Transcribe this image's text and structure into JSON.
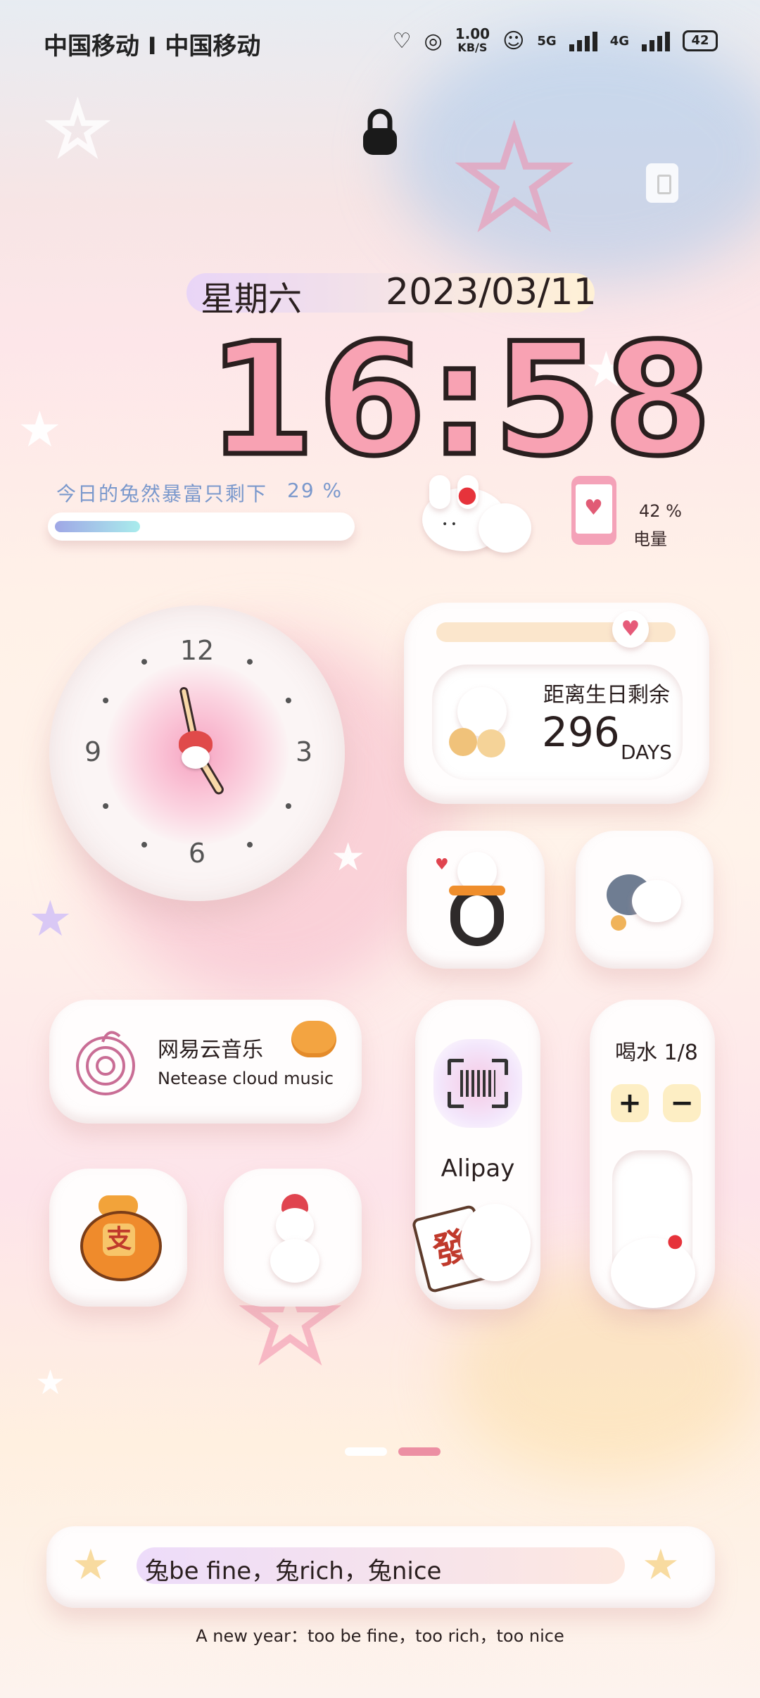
{
  "status_bar": {
    "carrier": "中国移动 I 中国移动",
    "speed_value": "1.00",
    "speed_unit": "KB/S",
    "net1": "5G",
    "net2": "4G",
    "battery": "42"
  },
  "lock": {
    "icon": "lock-icon"
  },
  "date": {
    "weekday": "星期六",
    "date": "2023/03/11"
  },
  "time": "16:58",
  "wealth": {
    "text": "今日的兔然暴富只剩下",
    "percent": "29 %",
    "progress": 0.29
  },
  "phone_battery": {
    "percent": "42 %",
    "label": "电量"
  },
  "clock": {
    "n12": "12",
    "n3": "3",
    "n6": "6",
    "n9": "9",
    "hour": 16,
    "minute": 58
  },
  "birthday": {
    "title": "距离生日剩余",
    "days": "296",
    "unit": "DAYS"
  },
  "music": {
    "title": "网易云音乐",
    "subtitle": "Netease cloud music"
  },
  "alipay": {
    "label": "Alipay",
    "badge": "發",
    "pay_glyph": "支"
  },
  "water": {
    "title": "喝水",
    "count": "1",
    "total": "/8",
    "plus": "+",
    "minus": "−"
  },
  "pager": {
    "pages": 2,
    "current": 1
  },
  "slogan": {
    "text": "兔be fine，兔rich，兔nice",
    "caption": "A new year：too be fine，too rich，too nice"
  },
  "colors": {
    "accent_pink": "#f48fa5",
    "text_dark": "#2a1f1f",
    "progress_blue": "#7da8e8"
  }
}
